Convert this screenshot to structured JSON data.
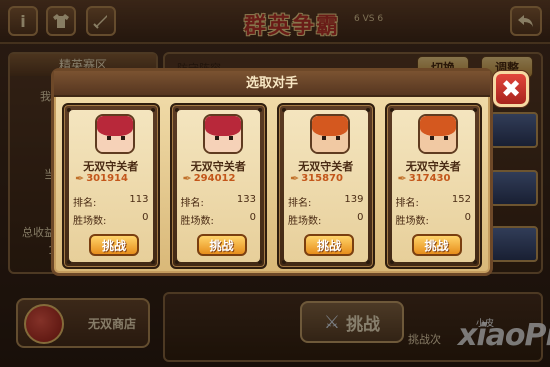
{
  "header": {
    "title": "群英争霸",
    "mode": "6 VS 6",
    "info_icon": "info-icon",
    "team_icon": "shirt-icon",
    "battle_icon": "sword-icon",
    "back_icon": "back-arrow-icon"
  },
  "left_panel": {
    "title": "精英赛区",
    "line1": "我",
    "line2": "当",
    "line3": "总收益",
    "line4": "1"
  },
  "right_panel": {
    "label": "防守阵容",
    "switch_label": "切换",
    "adjust_label": "调整"
  },
  "shop": {
    "label": "无双商店"
  },
  "bottom": {
    "fight_label": "挑战",
    "hint": "挑战次"
  },
  "watermark": {
    "text": "xiaoPi",
    "small": "小皮"
  },
  "dialog": {
    "title": "选取对手",
    "close_icon": "close-icon",
    "rank_label": "排名:",
    "wins_label": "胜场数:",
    "fight_label": "挑战",
    "opponents": [
      {
        "name": "无双守关者",
        "power": "301914",
        "rank": "113",
        "wins": "0",
        "hair": "#b8283a",
        "face": "#f6d2b8"
      },
      {
        "name": "无双守关者",
        "power": "294012",
        "rank": "133",
        "wins": "0",
        "hair": "#b8283a",
        "face": "#f6d2b8"
      },
      {
        "name": "无双守关者",
        "power": "315870",
        "rank": "139",
        "wins": "0",
        "hair": "#d4581f",
        "face": "#f1c9a3"
      },
      {
        "name": "无双守关者",
        "power": "317430",
        "rank": "152",
        "wins": "0",
        "hair": "#d4581f",
        "face": "#f1c9a3"
      }
    ]
  }
}
